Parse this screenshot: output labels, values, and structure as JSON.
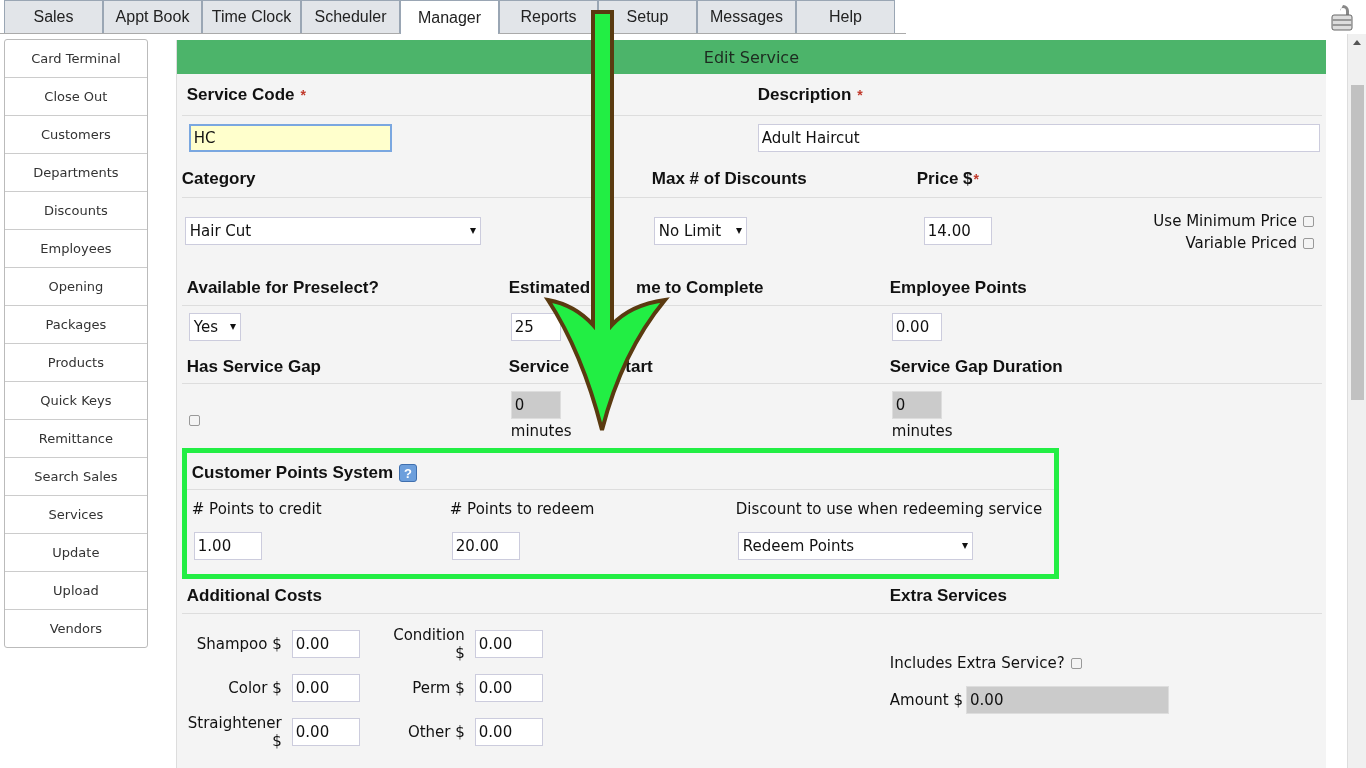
{
  "tabs": [
    {
      "label": "Sales",
      "selected": false
    },
    {
      "label": "Appt Book",
      "selected": false
    },
    {
      "label": "Time Clock",
      "selected": false
    },
    {
      "label": "Scheduler",
      "selected": false
    },
    {
      "label": "Manager",
      "selected": true
    },
    {
      "label": "Reports",
      "selected": false
    },
    {
      "label": "Setup",
      "selected": false
    },
    {
      "label": "Messages",
      "selected": false
    },
    {
      "label": "Help",
      "selected": false
    }
  ],
  "sidebar": {
    "items": [
      "Card Terminal",
      "Close Out",
      "Customers",
      "Departments",
      "Discounts",
      "Employees",
      "Opening",
      "Packages",
      "Products",
      "Quick Keys",
      "Remittance",
      "Search Sales",
      "Services",
      "Update",
      "Upload",
      "Vendors"
    ]
  },
  "form": {
    "title": "Edit Service",
    "service_code": {
      "label": "Service Code",
      "required_mark": "*",
      "value": "HC",
      "focused": true
    },
    "description": {
      "label": "Description",
      "required_mark": "*",
      "value": "Adult Haircut",
      "focused": false
    },
    "category": {
      "label": "Category",
      "value": "Hair Cut"
    },
    "max_discounts": {
      "label": "Max # of Discounts",
      "value": "No Limit"
    },
    "price": {
      "label": "Price $",
      "required_mark": "*",
      "value": "14.00"
    },
    "price_options": [
      {
        "label": "Use Minimum Price",
        "checked": false
      },
      {
        "label": "Variable Priced",
        "checked": false
      }
    ],
    "preselect": {
      "label": "Available for Preselect?",
      "value": "Yes"
    },
    "estimated_time": {
      "label_parts": [
        "Estimated",
        "me to Complete"
      ],
      "value": "25"
    },
    "employee_points": {
      "label": "Employee Points",
      "value": "0.00"
    },
    "has_service_gap": {
      "label": "Has Service Gap",
      "checked": false
    },
    "gap_start": {
      "label_parts": [
        "Service",
        "tart"
      ],
      "value": "0",
      "unit": "minutes",
      "disabled": true
    },
    "gap_duration": {
      "label": "Service Gap Duration",
      "value": "0",
      "unit": "minutes",
      "disabled": true
    },
    "customer_points": {
      "title": "Customer Points System",
      "help": "?",
      "fields": [
        {
          "label": "# Points to credit",
          "value": "1.00",
          "kind": "input"
        },
        {
          "label": "# Points to redeem",
          "value": "20.00",
          "kind": "input"
        },
        {
          "label": "Discount to use when redeeming service",
          "value": "Redeem Points",
          "kind": "select"
        }
      ]
    },
    "additional_costs": {
      "title": "Additional Costs",
      "items": [
        {
          "label": "Shampoo $",
          "value": "0.00"
        },
        {
          "label": "Condition $",
          "value": "0.00"
        },
        {
          "label": "Color $",
          "value": "0.00"
        },
        {
          "label": "Perm $",
          "value": "0.00"
        },
        {
          "label": "Straightener $",
          "value": "0.00"
        },
        {
          "label": "Other $",
          "value": "0.00"
        }
      ]
    },
    "extra_services": {
      "title": "Extra Services",
      "includes": {
        "label": "Includes Extra Service?",
        "checked": false
      },
      "amount": {
        "label": "Amount $",
        "value": "0.00",
        "disabled": true
      }
    }
  }
}
